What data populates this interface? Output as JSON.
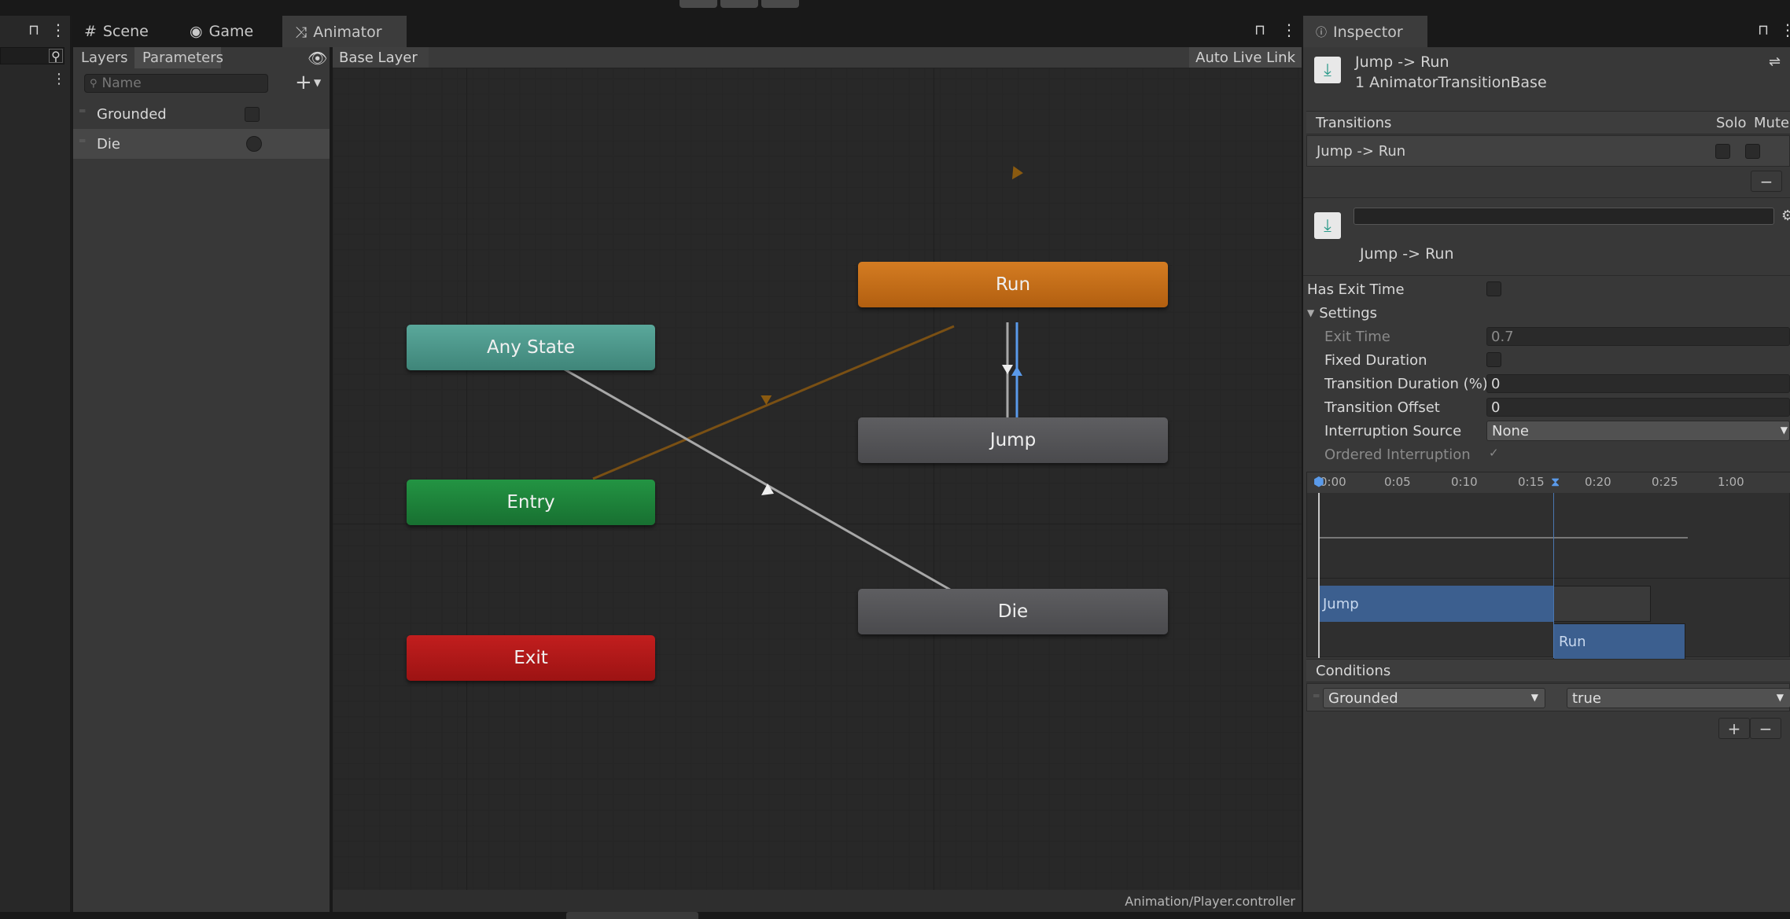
{
  "tabs": {
    "scene": "Scene",
    "game": "Game",
    "animator": "Animator",
    "inspector": "Inspector"
  },
  "params_panel": {
    "tab_layers": "Layers",
    "tab_parameters": "Parameters",
    "search_placeholder": "Name",
    "parameters": [
      {
        "name": "Grounded",
        "type": "bool"
      },
      {
        "name": "Die",
        "type": "trigger"
      }
    ]
  },
  "graph": {
    "breadcrumb": "Base Layer",
    "auto_live_link": "Auto Live Link",
    "footer_path": "Animation/Player.controller",
    "nodes": {
      "run": "Run",
      "any_state": "Any State",
      "jump": "Jump",
      "entry": "Entry",
      "die": "Die",
      "exit": "Exit"
    },
    "colors": {
      "run": "#c6721a",
      "any_state": "#4e9a8e",
      "entry": "#1d7f38",
      "exit": "#b01818",
      "state": "#555558",
      "transition": "#a0a0a0",
      "selected_transition": "#5a9aea",
      "entry_transition": "#8a5a10"
    }
  },
  "inspector": {
    "title": "Jump -> Run",
    "subtitle": "1 AnimatorTransitionBase",
    "transitions_header": "Transitions",
    "solo_label": "Solo",
    "mute_label": "Mute",
    "transition_item": "Jump -> Run",
    "detail_name": "Jump -> Run",
    "has_exit_time_label": "Has Exit Time",
    "settings_label": "Settings",
    "exit_time_label": "Exit Time",
    "exit_time_value": "0.7",
    "fixed_duration_label": "Fixed Duration",
    "transition_duration_label": "Transition Duration (%)",
    "transition_duration_value": "0",
    "transition_offset_label": "Transition Offset",
    "transition_offset_value": "0",
    "interruption_source_label": "Interruption Source",
    "interruption_source_value": "None",
    "ordered_interruption_label": "Ordered Interruption",
    "timeline_ticks": [
      "0:00",
      "0:05",
      "0:10",
      "0:15",
      "0:20",
      "0:25",
      "1:00"
    ],
    "timeline_jump": "Jump",
    "timeline_run": "Run",
    "conditions_header": "Conditions",
    "condition_param": "Grounded",
    "condition_value": "true"
  }
}
